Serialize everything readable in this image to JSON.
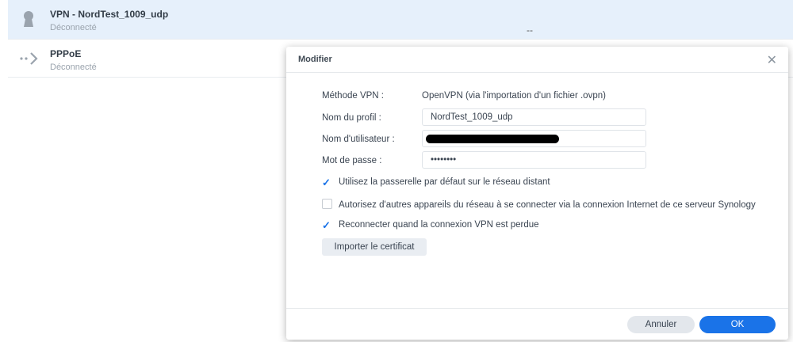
{
  "list": [
    {
      "title": "VPN - NordTest_1009_udp",
      "status": "Déconnecté",
      "extra": "--",
      "icon": "vpn-keyhole-icon"
    },
    {
      "title": "PPPoE",
      "status": "Déconnecté",
      "icon": "pppoe-arrow-icon"
    }
  ],
  "dialog": {
    "title": "Modifier",
    "method_label": "Méthode VPN :",
    "method_value": "OpenVPN (via l'importation d'un fichier .ovpn)",
    "profile_label": "Nom du profil :",
    "profile_value": "NordTest_1009_udp",
    "user_label": "Nom d'utilisateur :",
    "pass_label": "Mot de passe :",
    "pass_value": "••••••••",
    "cb1": "Utilisez la passerelle par défaut sur le réseau distant",
    "cb2": "Autorisez d'autres appareils du réseau à se connecter via la connexion Internet de ce serveur Synology",
    "cb3": "Reconnecter quand la connexion VPN est perdue",
    "import": "Importer le certificat",
    "cancel": "Annuler",
    "ok": "OK"
  }
}
